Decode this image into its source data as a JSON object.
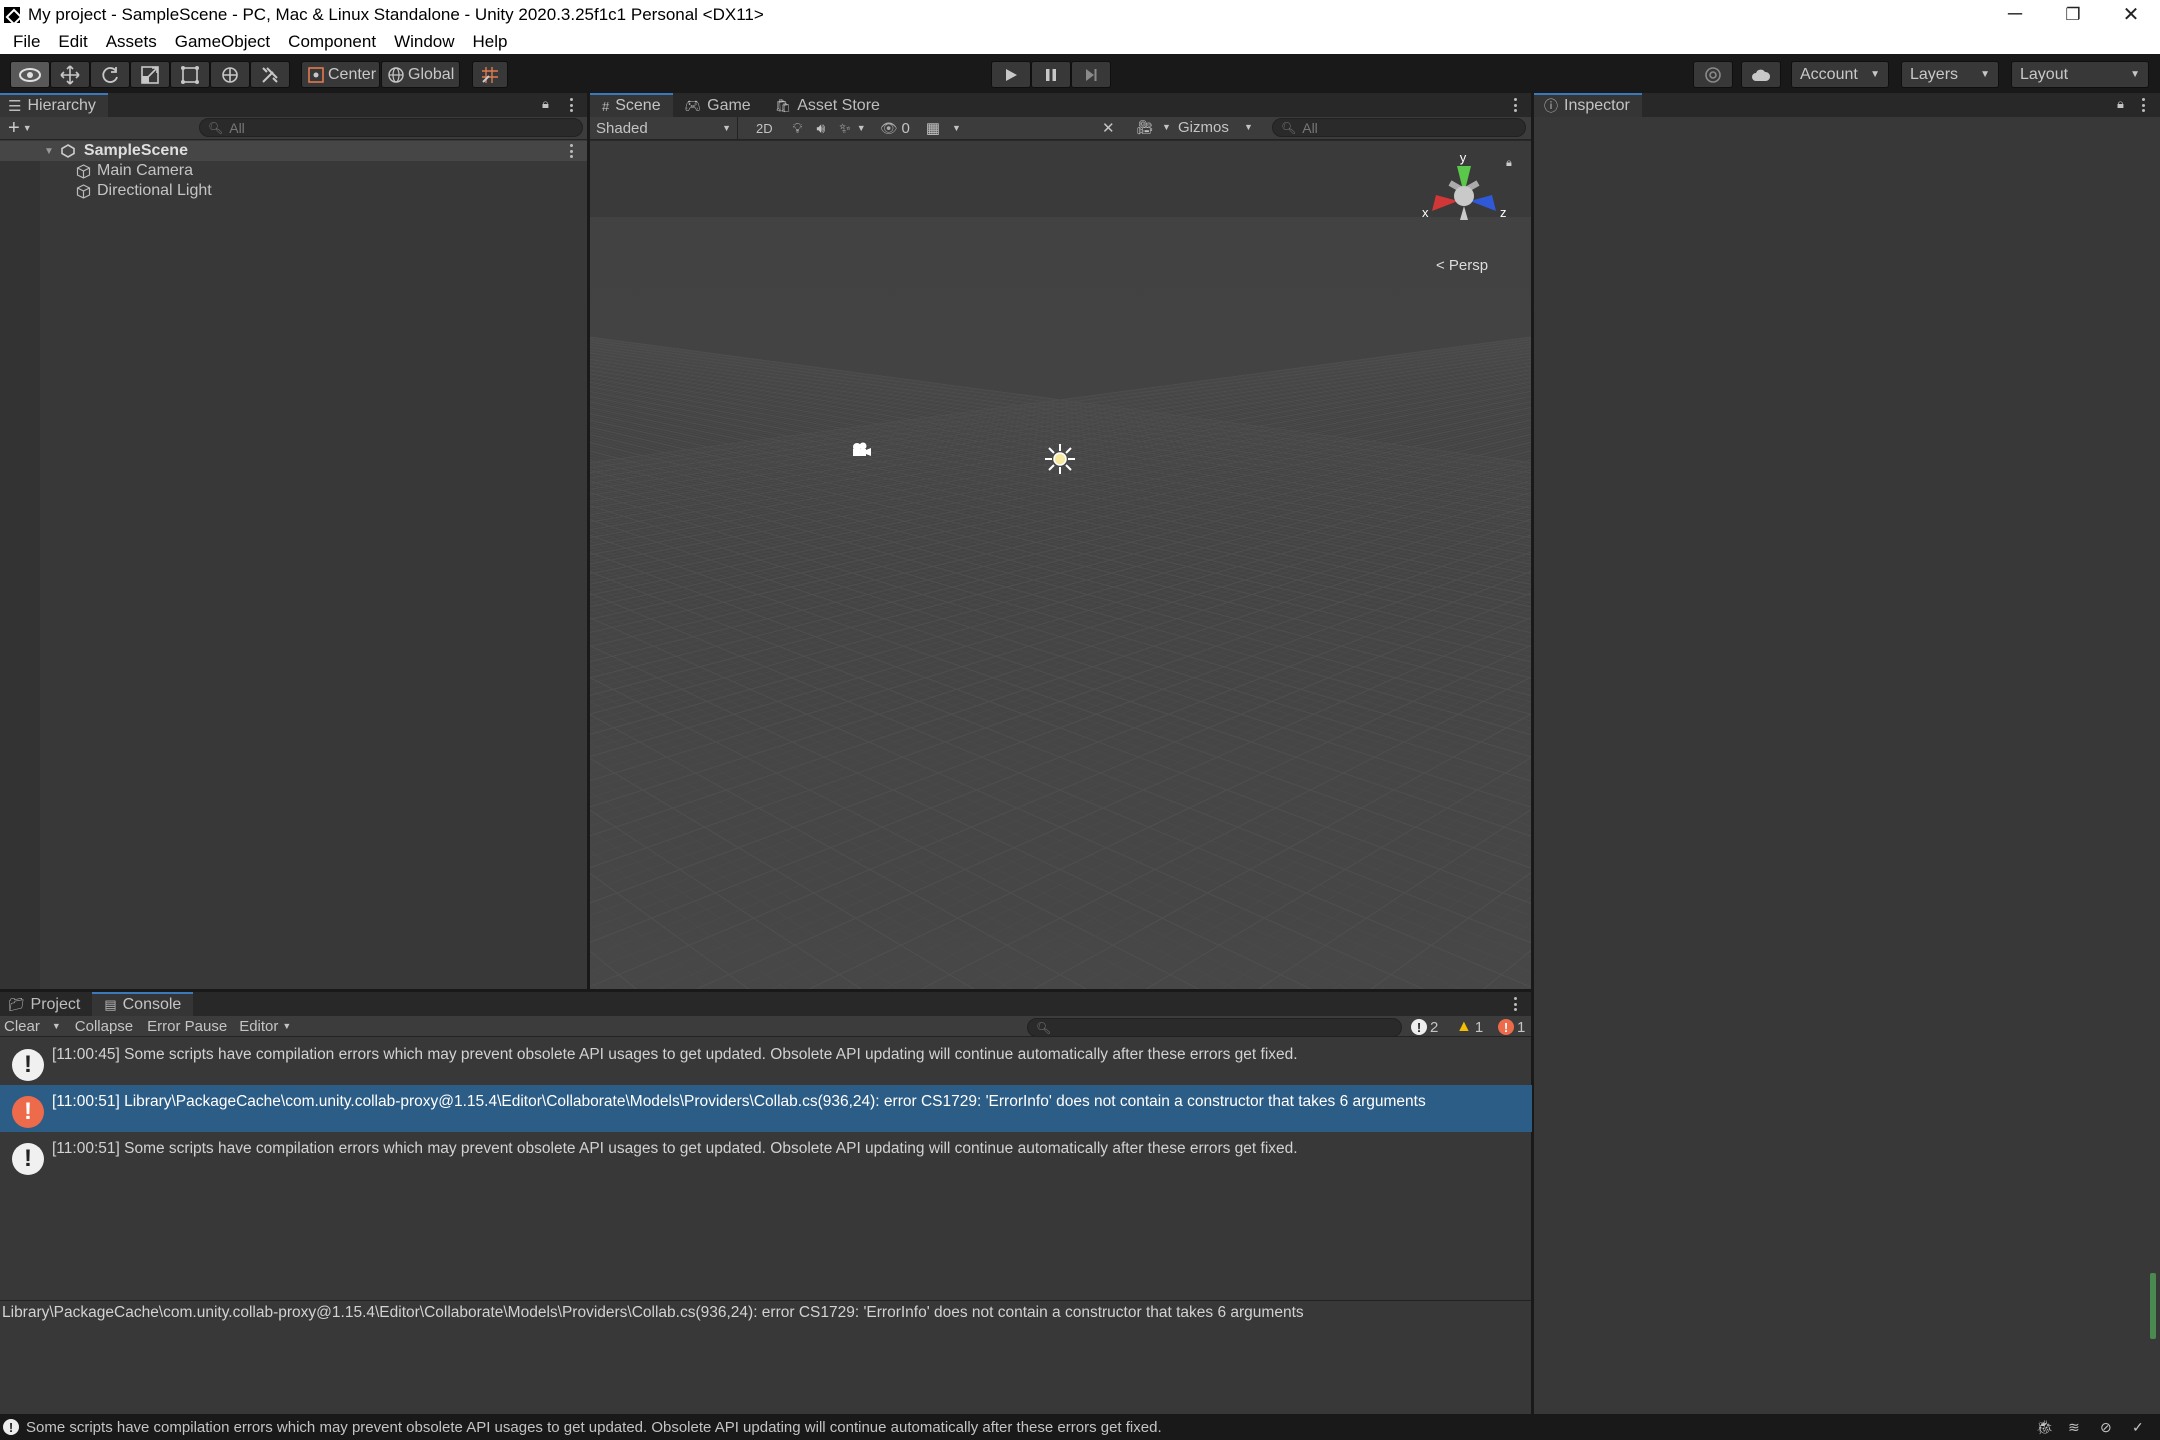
{
  "window": {
    "title": "My project - SampleScene - PC, Mac & Linux Standalone - Unity 2020.3.25f1c1 Personal <DX11>",
    "minimize": "─",
    "restore": "❐",
    "close": "✕"
  },
  "menu": [
    "File",
    "Edit",
    "Assets",
    "GameObject",
    "Component",
    "Window",
    "Help"
  ],
  "toolbar": {
    "pivot_label": "Center",
    "space_label": "Global",
    "account_label": "Account",
    "layers_label": "Layers",
    "layout_label": "Layout"
  },
  "hierarchy": {
    "tab_label": "Hierarchy",
    "search_placeholder": "All",
    "scene_name": "SampleScene",
    "objects": [
      "Main Camera",
      "Directional Light"
    ]
  },
  "scene_view": {
    "tabs": [
      "Scene",
      "Game",
      "Asset Store"
    ],
    "shading_mode": "Shaded",
    "mode_2d": "2D",
    "hidden_count": "0",
    "gizmos_label": "Gizmos",
    "search_placeholder": "All",
    "gizmo_axes": {
      "y": "y",
      "x": "x",
      "z": "z"
    },
    "projection": "< Persp"
  },
  "inspector": {
    "tab_label": "Inspector"
  },
  "bottom_tabs": [
    "Project",
    "Console"
  ],
  "console": {
    "clear_label": "Clear",
    "collapse_label": "Collapse",
    "error_pause_label": "Error Pause",
    "editor_label": "Editor",
    "counts": {
      "info": "2",
      "warning": "1",
      "error": "1"
    },
    "messages": [
      {
        "type": "info",
        "text": "[11:00:45] Some scripts have compilation errors which may prevent obsolete API usages to get updated. Obsolete API updating will continue automatically after these errors get fixed."
      },
      {
        "type": "error",
        "text": "[11:00:51] Library\\PackageCache\\com.unity.collab-proxy@1.15.4\\Editor\\Collaborate\\Models\\Providers\\Collab.cs(936,24): error CS1729: 'ErrorInfo' does not contain a constructor that takes 6 arguments"
      },
      {
        "type": "info",
        "text": "[11:00:51] Some scripts have compilation errors which may prevent obsolete API usages to get updated. Obsolete API updating will continue automatically after these errors get fixed."
      }
    ],
    "detail": "Library\\PackageCache\\com.unity.collab-proxy@1.15.4\\Editor\\Collaborate\\Models\\Providers\\Collab.cs(936,24): error CS1729: 'ErrorInfo' does not contain a constructor that takes 6 arguments"
  },
  "status": {
    "message": "Some scripts have compilation errors which may prevent obsolete API usages to get updated. Obsolete API updating will continue automatically after these errors get fixed."
  },
  "colors": {
    "selection": "#2c5d87",
    "error": "#ed6a4b",
    "warning": "#f4bc02",
    "tab_accent": "#3a79bb"
  }
}
